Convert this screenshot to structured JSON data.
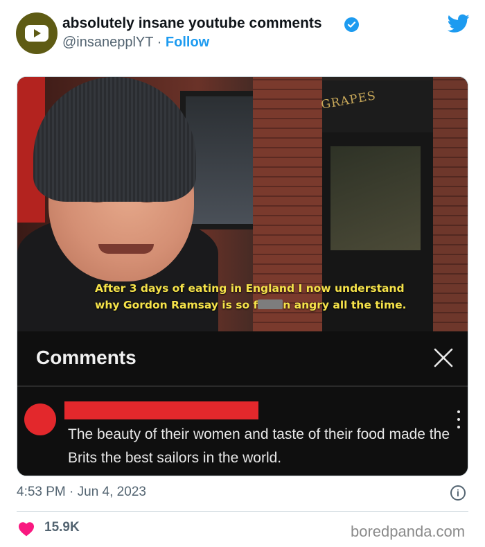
{
  "header": {
    "display_name": "absolutely insane youtube comments",
    "handle": "@insanepplYT",
    "separator": "·",
    "follow_label": "Follow"
  },
  "media": {
    "sign_text": "GRAPES",
    "caption_line1": "After 3 days of eating in England I now understand",
    "caption_line2_before": "why Gordon Ramsay is so f",
    "caption_line2_after": "n angry all the time.",
    "comments_title": "Comments",
    "comment_text": "The beauty of their women and taste of their food made the Brits the best sailors in the world."
  },
  "footer": {
    "timestamp": "4:53 PM · Jun 4, 2023",
    "likes": "15.9K",
    "watermark": "boredpanda.com"
  },
  "colors": {
    "accent": "#1d9bf0",
    "heart": "#f91880",
    "avatar": "#5e5b14",
    "redaction": "#e3282c"
  },
  "icons": [
    "youtube-logo-avatar",
    "verified-badge-icon",
    "twitter-bird-icon",
    "close-icon",
    "more-vert-icon",
    "info-icon",
    "heart-icon"
  ]
}
